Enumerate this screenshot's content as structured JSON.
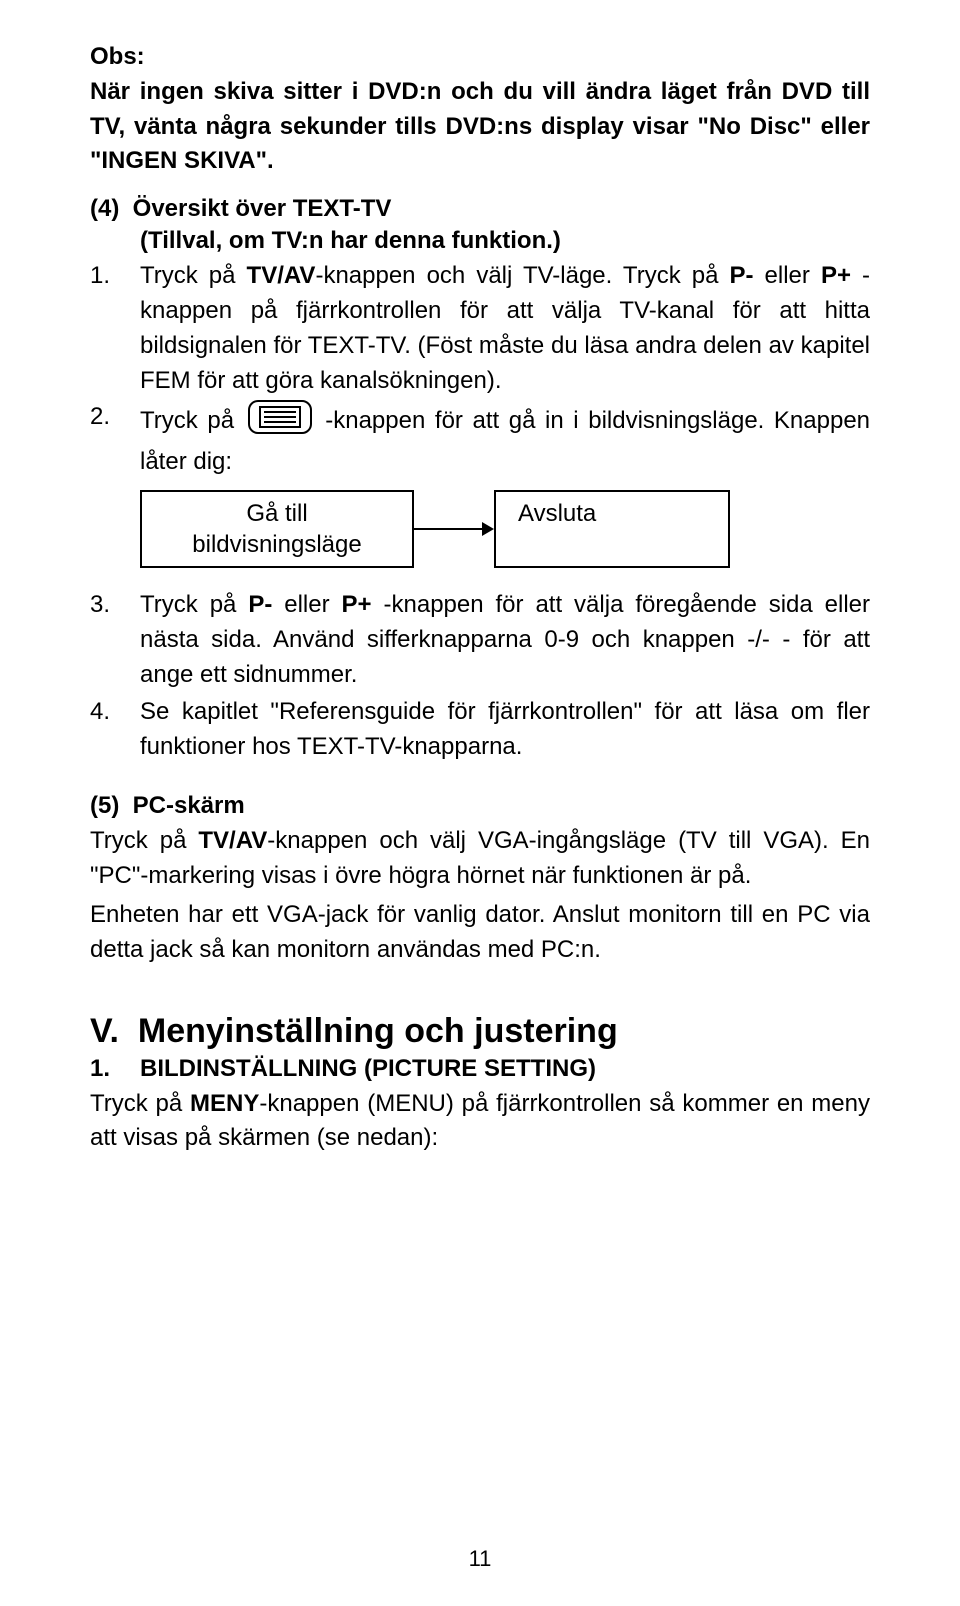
{
  "obs": {
    "heading": "Obs:",
    "text": "När ingen skiva sitter i DVD:n och du vill ändra läget från DVD till TV, vänta några sekunder tills DVD:ns display visar \"No Disc\" eller \"INGEN SKIVA\"."
  },
  "sec4": {
    "title": "(4)  Översikt över TEXT-TV",
    "subtitle": "(Tillval, om TV:n har denna funktion.)",
    "items": [
      {
        "num": "1.",
        "pre": "Tryck på ",
        "bold1": "TV/AV",
        "mid1": "-knappen och välj TV-läge. Tryck på ",
        "bold2": "P-",
        "mid2": " eller ",
        "bold3": "P+",
        "post": " -knappen på fjärrkontrollen för att välja TV-kanal för att hitta bildsignalen för TEXT-TV. (Föst måste du läsa andra delen av kapitel FEM för att göra kanalsökningen)."
      },
      {
        "num": "2.",
        "pre": "Tryck på ",
        "post": "-knappen för att gå in i bildvisningsläge. Knappen låter dig:"
      }
    ],
    "flow": {
      "left1": "Gå till",
      "left2": "bildvisningsläge",
      "right": "Avsluta"
    },
    "items2": [
      {
        "num": "3.",
        "pre": "Tryck på ",
        "bold1": "P-",
        "mid1": " eller ",
        "bold2": "P+",
        "post": " -knappen för att välja föregående sida eller nästa sida. Använd sifferknapparna 0-9 och knappen -/- - för att ange ett sidnummer."
      },
      {
        "num": "4.",
        "text": "Se kapitlet \"Referensguide för fjärrkontrollen\" för att läsa om fler funktioner hos TEXT-TV-knapparna."
      }
    ]
  },
  "sec5": {
    "title": "(5)  PC-skärm",
    "p1_pre": "Tryck på ",
    "p1_bold": "TV/AV",
    "p1_post": "-knappen och välj VGA-ingångsläge (TV till VGA). En \"PC\"-markering visas i övre högra hörnet när funktionen är på.",
    "p2": "Enheten har ett VGA-jack för vanlig dator. Anslut monitorn till en PC via detta jack så kan monitorn användas med PC:n."
  },
  "chapterV": {
    "heading": "V.  Menyinställning och justering",
    "sub_num": "1.",
    "sub_title": "BILDINSTÄLLNING (PICTURE SETTING)",
    "body_pre": "Tryck på ",
    "body_bold": "MENY",
    "body_post": "-knappen (MENU) på fjärrkontrollen så kommer en meny att visas på skärmen (se nedan):"
  },
  "pagenum": "11"
}
